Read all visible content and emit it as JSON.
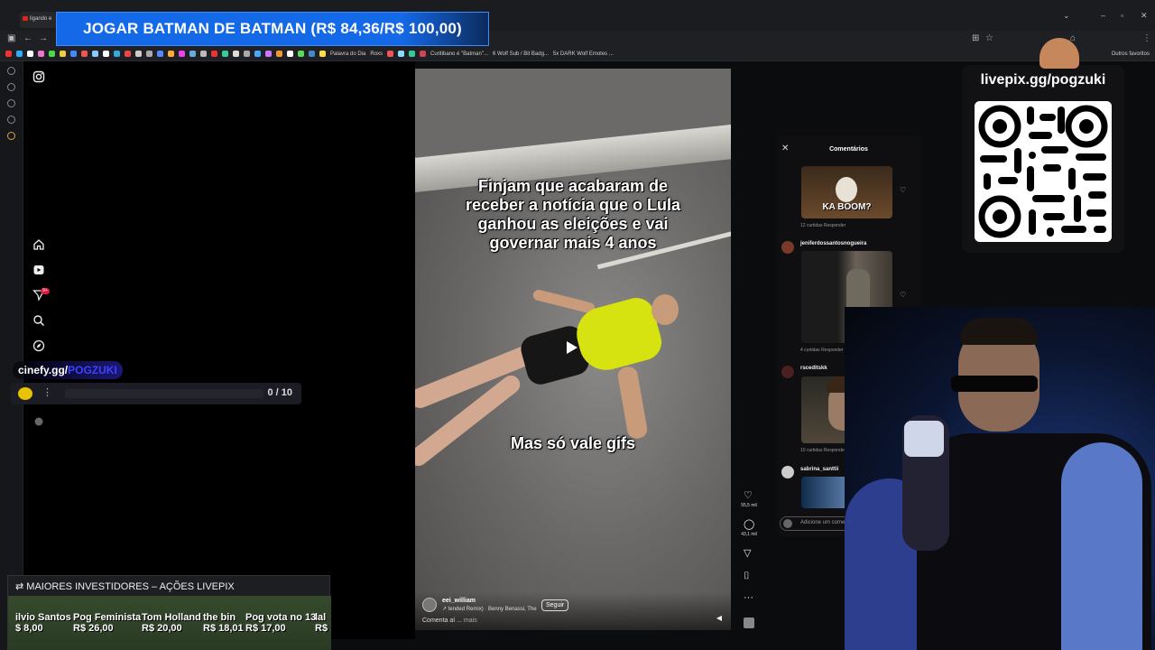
{
  "browser": {
    "tab_title": "ligando e",
    "bookmarks": [
      "Palavra do Dia",
      "Roxs",
      "Curitibano é \"Batman\"...",
      "6 Wolf Sub / Bit Badg...",
      "5x DARK Wolf Emotes ...",
      "Outros favoritos"
    ],
    "bookmark_colors": [
      "#e33",
      "#3af",
      "#fff",
      "#e7c",
      "#4d4",
      "#ec4",
      "#48f",
      "#e55",
      "#8cf",
      "#fff",
      "#3ad",
      "#e44",
      "#ccc",
      "#aaa",
      "#58f",
      "#fa3",
      "#e4e",
      "#6ad",
      "#bbb",
      "#e33",
      "#3c9",
      "#ddd",
      "#aaa",
      "#4af",
      "#c7f",
      "#e93",
      "#fff",
      "#5d5",
      "#48c",
      "#fd4",
      "#e55",
      "#8df",
      "#3c9",
      "#c45"
    ]
  },
  "banner": {
    "text": "JOGAR BATMAN DE BATMAN (R$ 84,36/R$ 100,00)"
  },
  "cinefy": {
    "tag_prefix": "cinefy.gg/",
    "tag_suffix": "POGZUKI",
    "count": "0 / 10"
  },
  "video": {
    "overlay_top": "Finjam que acabaram de receber a notícia que o Lula ganhou as eleições e vai governar mais 4 anos",
    "overlay_bottom": "Mas só vale gifs",
    "username": "eei_william",
    "music": "↗ tended Remix) · Benny Benassi, The",
    "follow_label": "Seguir",
    "caption": "Comenta aí ...",
    "caption_more": "mais",
    "likes": "55,5 mil",
    "comments_count": "43,1 mil"
  },
  "comments": {
    "title": "Comentários",
    "items": [
      {
        "user": "",
        "gif_text": "KA BOOM?",
        "meta": "12 curtidas   Responder"
      },
      {
        "user": "jeniferdossantosnogueira",
        "gif_text": "",
        "meta": "4 curtidas   Responder   ···"
      },
      {
        "user": "rsceditskk",
        "gif_text": "",
        "meta": "10 curtidas   Responder"
      },
      {
        "user": "sabrina_santtii",
        "gif_text": "",
        "meta": ""
      }
    ],
    "input_placeholder": "Adicione um comentário..."
  },
  "qr": {
    "url": "livepix.gg/pogzuki"
  },
  "investors": {
    "title": "MAIORES INVESTIDORES – AÇÕES LIVEPIX",
    "items": [
      {
        "name": "ilvio Santos",
        "value": "$ 8,00"
      },
      {
        "name": "Pog Feminista",
        "value": "R$ 26,00"
      },
      {
        "name": "Tom Holland",
        "value": "R$ 20,00"
      },
      {
        "name": "the bin",
        "value": "R$ 18,01"
      },
      {
        "name": "Pog vota no 13",
        "value": "R$ 17,00"
      },
      {
        "name": "lal",
        "value": "R$"
      }
    ]
  }
}
